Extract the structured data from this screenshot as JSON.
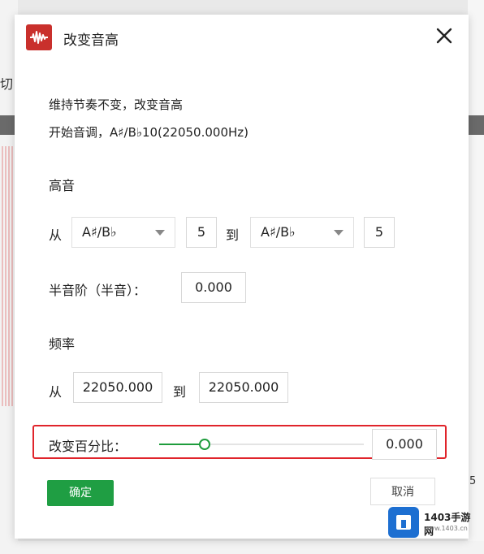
{
  "background": {
    "left_label": "切",
    "right_label": "5"
  },
  "dialog": {
    "title": "改变音高",
    "icon": "waveform-app-icon",
    "close_icon": "close-icon",
    "description_line1": "维持节奏不变，改变音高",
    "description_line2": "开始音调，A♯/B♭10(22050.000Hz)"
  },
  "pitch": {
    "section_label": "高音",
    "from_label": "从",
    "from_note": "A♯/B♭",
    "from_octave": "5",
    "to_label": "到",
    "to_note": "A♯/B♭",
    "to_octave": "5",
    "semitone_label": "半音阶（半音）：",
    "semitone_value": "0.000"
  },
  "frequency": {
    "section_label": "频率",
    "from_label": "从",
    "from_value": "22050.000",
    "to_label": "到",
    "to_value": "22050.000"
  },
  "percent": {
    "label": "改变百分比：",
    "value": "0.000",
    "slider_fraction": 0.22
  },
  "buttons": {
    "ok": "确定",
    "cancel": "取消"
  },
  "watermark": {
    "text": "1403手游网",
    "sub": "www.1403.cn"
  },
  "colors": {
    "accent": "#1f9e43",
    "highlight": "#e0242b",
    "icon_bg": "#c9302c"
  }
}
